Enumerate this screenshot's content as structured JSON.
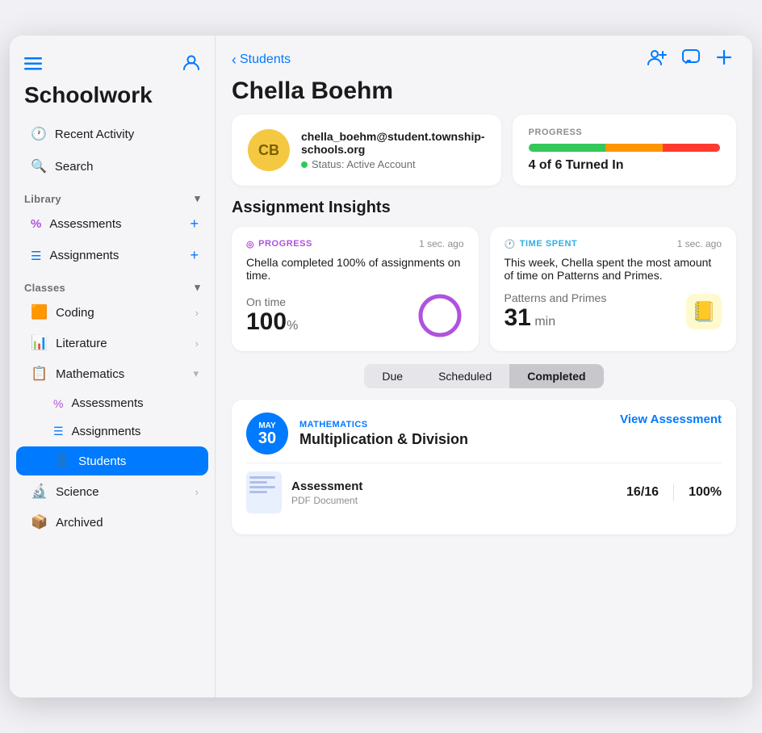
{
  "app": {
    "title": "Schoolwork",
    "sidebar_toggle_icon": "sidebar-icon",
    "account_icon": "account-icon"
  },
  "sidebar": {
    "nav_items": [
      {
        "id": "recent-activity",
        "icon": "🕐",
        "label": "Recent Activity"
      },
      {
        "id": "search",
        "icon": "🔍",
        "label": "Search"
      }
    ],
    "library": {
      "label": "Library",
      "items": [
        {
          "id": "lib-assessments",
          "icon": "%",
          "label": "Assessments",
          "has_plus": true
        },
        {
          "id": "lib-assignments",
          "icon": "☰",
          "label": "Assignments",
          "has_plus": true
        }
      ]
    },
    "classes": {
      "label": "Classes",
      "items": [
        {
          "id": "coding",
          "icon": "🟧",
          "label": "Coding",
          "has_chevron": true
        },
        {
          "id": "literature",
          "icon": "📊",
          "label": "Literature",
          "has_chevron": true
        },
        {
          "id": "mathematics",
          "icon": "📋",
          "label": "Mathematics",
          "expanded": true,
          "sub_items": [
            {
              "id": "math-assessments",
              "icon": "%",
              "label": "Assessments"
            },
            {
              "id": "math-assignments",
              "icon": "☰",
              "label": "Assignments"
            },
            {
              "id": "math-students",
              "icon": "👤",
              "label": "Students",
              "active": true
            }
          ]
        },
        {
          "id": "science",
          "icon": "🔬",
          "label": "Science",
          "has_chevron": true
        }
      ]
    },
    "archived": {
      "id": "archived",
      "icon": "📦",
      "label": "Archived"
    }
  },
  "main": {
    "back_label": "Students",
    "student_name": "Chella Boehm",
    "avatar_initials": "CB",
    "avatar_color": "#f5c842",
    "student_email": "chella_boehm@student.township-schools.org",
    "student_status": "Status: Active Account",
    "progress": {
      "label": "PROGRESS",
      "bar_segments": [
        {
          "color": "#34c759",
          "pct": 40
        },
        {
          "color": "#ff9500",
          "pct": 30
        },
        {
          "color": "#ff3b30",
          "pct": 30
        }
      ],
      "summary": "4 of 6 Turned In"
    },
    "insights_title": "Assignment Insights",
    "insights": [
      {
        "type": "PROGRESS",
        "type_icon": "◎",
        "timestamp": "1 sec. ago",
        "description": "Chella completed 100% of assignments on time.",
        "metric_label": "On time",
        "metric_value": "100",
        "metric_unit": "%",
        "has_donut": true,
        "donut_pct": 100,
        "donut_color": "#af52de"
      },
      {
        "type": "TIME SPENT",
        "type_icon": "🕐",
        "timestamp": "1 sec. ago",
        "description": "This week, Chella spent the most amount of time on Patterns and Primes.",
        "metric_label": "Patterns and Primes",
        "metric_value": "31",
        "metric_unit": "min",
        "has_subject_icon": true,
        "subject_icon": "📒"
      }
    ],
    "tabs": [
      {
        "id": "due",
        "label": "Due"
      },
      {
        "id": "scheduled",
        "label": "Scheduled"
      },
      {
        "id": "completed",
        "label": "Completed",
        "active": true
      }
    ],
    "assignments": [
      {
        "date_month": "MAY",
        "date_day": "30",
        "subject": "MATHEMATICS",
        "name": "Multiplication & Division",
        "action_label": "View Assessment",
        "items": [
          {
            "doc_name": "Assessment",
            "doc_type": "PDF Document",
            "score": "16/16",
            "score_pct": "100%"
          }
        ]
      }
    ]
  },
  "topbar_actions": [
    {
      "id": "add-student",
      "icon": "👤+"
    },
    {
      "id": "message",
      "icon": "💬"
    },
    {
      "id": "add",
      "icon": "+"
    }
  ]
}
